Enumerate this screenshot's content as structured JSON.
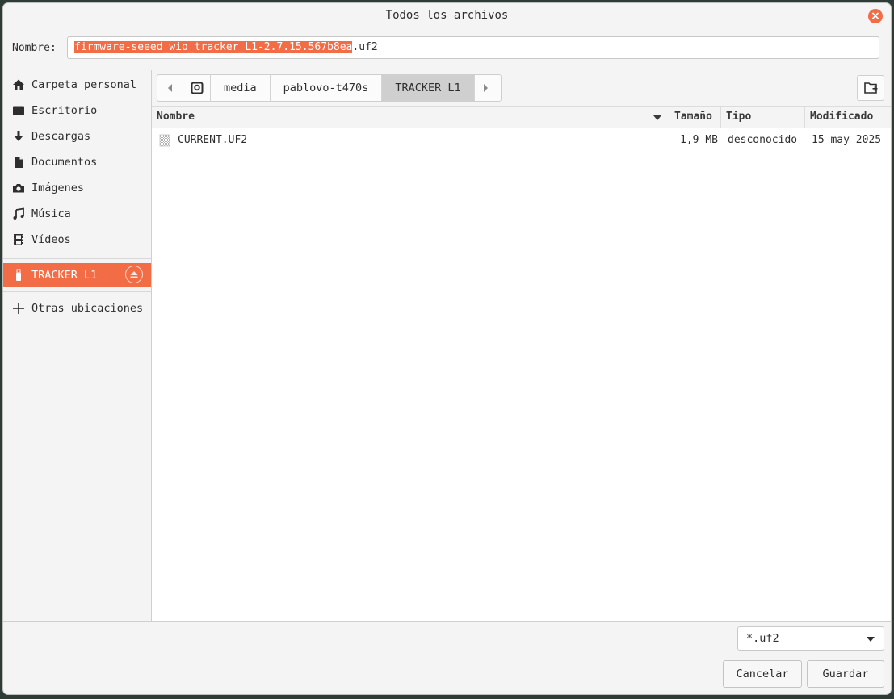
{
  "window": {
    "title": "Todos los archivos",
    "close_icon": "close-icon"
  },
  "filename": {
    "label": "Nombre:",
    "selected_part": "firmware-seeed_wio_tracker_L1-2.7.15.567b8ea",
    "extension_part": ".uf2"
  },
  "sidebar": {
    "items": [
      {
        "label": "Carpeta personal",
        "icon": "home-icon"
      },
      {
        "label": "Escritorio",
        "icon": "desktop-icon"
      },
      {
        "label": "Descargas",
        "icon": "download-icon"
      },
      {
        "label": "Documentos",
        "icon": "document-icon"
      },
      {
        "label": "Imágenes",
        "icon": "camera-icon"
      },
      {
        "label": "Música",
        "icon": "music-icon"
      },
      {
        "label": "Vídeos",
        "icon": "film-icon"
      }
    ],
    "device": {
      "label": "TRACKER L1",
      "icon": "usb-drive-icon",
      "eject_icon": "eject-icon"
    },
    "other": {
      "label": "Otras ubicaciones",
      "icon": "plus-icon"
    }
  },
  "pathbar": {
    "crumbs": [
      "media",
      "pablovo-t470s",
      "TRACKER L1"
    ],
    "current": "TRACKER L1"
  },
  "table": {
    "headers": {
      "name": "Nombre",
      "size": "Tamaño",
      "type": "Tipo",
      "modified": "Modificado"
    },
    "rows": [
      {
        "name": "CURRENT.UF2",
        "size": "1,9 MB",
        "type": "desconocido",
        "modified": "15 may 2025"
      }
    ]
  },
  "filter": {
    "value": "*.uf2"
  },
  "buttons": {
    "cancel": "Cancelar",
    "save": "Guardar"
  },
  "colors": {
    "accent": "#f26d46"
  }
}
